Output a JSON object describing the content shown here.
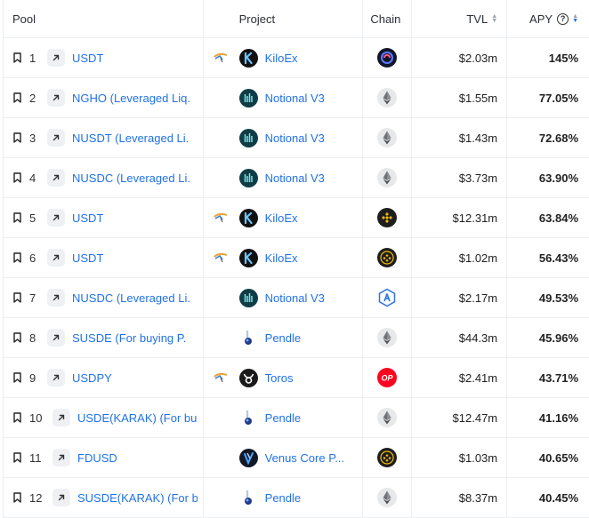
{
  "headers": {
    "pool": "Pool",
    "project": "Project",
    "chain": "Chain",
    "tvl": "TVL",
    "apy": "APY",
    "apy_info": "?"
  },
  "rows": [
    {
      "rank": "1",
      "pool": "USDT",
      "leveraged": true,
      "project": "KiloEx",
      "project_icon": "kiloex",
      "chain": "chain-dark-swirl",
      "tvl": "$2.03m",
      "apy": "145%"
    },
    {
      "rank": "2",
      "pool": "NGHO (Leveraged Liq.",
      "leveraged": false,
      "project": "Notional V3",
      "project_icon": "notional",
      "chain": "ethereum",
      "tvl": "$1.55m",
      "apy": "77.05%"
    },
    {
      "rank": "3",
      "pool": "NUSDT (Leveraged Li.",
      "leveraged": false,
      "project": "Notional V3",
      "project_icon": "notional",
      "chain": "ethereum",
      "tvl": "$1.43m",
      "apy": "72.68%"
    },
    {
      "rank": "4",
      "pool": "NUSDC (Leveraged Li.",
      "leveraged": false,
      "project": "Notional V3",
      "project_icon": "notional",
      "chain": "ethereum",
      "tvl": "$3.73m",
      "apy": "63.90%"
    },
    {
      "rank": "5",
      "pool": "USDT",
      "leveraged": true,
      "project": "KiloEx",
      "project_icon": "kiloex",
      "chain": "bsc",
      "tvl": "$12.31m",
      "apy": "63.84%"
    },
    {
      "rank": "6",
      "pool": "USDT",
      "leveraged": true,
      "project": "KiloEx",
      "project_icon": "kiloex",
      "chain": "opbnb",
      "tvl": "$1.02m",
      "apy": "56.43%"
    },
    {
      "rank": "7",
      "pool": "NUSDC (Leveraged Li.",
      "leveraged": false,
      "project": "Notional V3",
      "project_icon": "notional",
      "chain": "arbitrum",
      "tvl": "$2.17m",
      "apy": "49.53%"
    },
    {
      "rank": "8",
      "pool": "SUSDE (For buying P.",
      "leveraged": false,
      "project": "Pendle",
      "project_icon": "pendle",
      "chain": "ethereum",
      "tvl": "$44.3m",
      "apy": "45.96%"
    },
    {
      "rank": "9",
      "pool": "USDPY",
      "leveraged": true,
      "project": "Toros",
      "project_icon": "toros",
      "chain": "optimism",
      "tvl": "$2.41m",
      "apy": "43.71%"
    },
    {
      "rank": "10",
      "pool": "USDE(KARAK) (For bu",
      "leveraged": false,
      "project": "Pendle",
      "project_icon": "pendle",
      "chain": "ethereum",
      "tvl": "$12.47m",
      "apy": "41.16%"
    },
    {
      "rank": "11",
      "pool": "FDUSD",
      "leveraged": false,
      "project": "Venus Core P...",
      "project_icon": "venus",
      "chain": "opbnb",
      "tvl": "$1.03m",
      "apy": "40.65%"
    },
    {
      "rank": "12",
      "pool": "SUSDE(KARAK) (For b",
      "leveraged": false,
      "project": "Pendle",
      "project_icon": "pendle",
      "chain": "ethereum",
      "tvl": "$8.37m",
      "apy": "40.45%"
    }
  ],
  "colors": {
    "link": "#2172e5",
    "sort_active": "#2172e5"
  },
  "chain_labels": {
    "optimism": "OP"
  }
}
